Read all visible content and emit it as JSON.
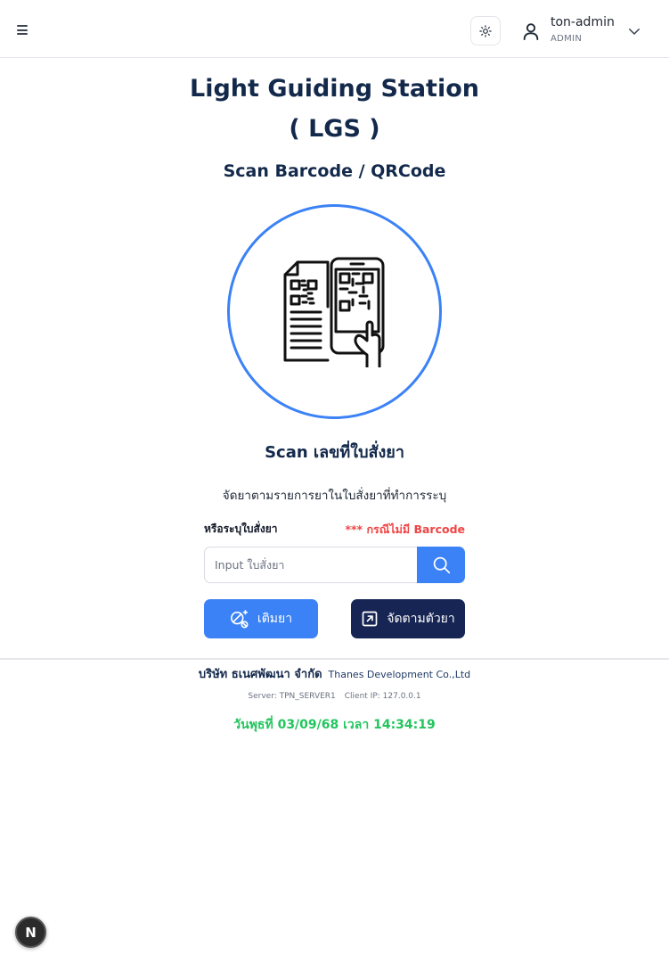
{
  "header": {
    "user_name": "ton-admin",
    "user_role": "ADMIN",
    "icons": {
      "menu": "hamburger-menu-icon",
      "theme": "sun-icon",
      "user": "user-icon",
      "dropdown": "chevron-down-icon"
    }
  },
  "main": {
    "title_line1": "Light Guiding Station",
    "title_line2": "( LGS )",
    "subtitle": "Scan Barcode / QRCode",
    "scan_label": "Scan เลขที่ใบสั่งยา",
    "instruction": "จัดยาตามรายการยาในใบสั่งยาที่ทำการระบุ",
    "field_label": "หรือระบุใบสั่งยา",
    "field_hint": "*** กรณีไม่มี Barcode",
    "search_input_value": "",
    "search_placeholder": "Input ใบสั่งยา",
    "refill_button_label": "เติมยา",
    "manual_button_label": "จัดตามตัวยา"
  },
  "footer": {
    "company_th": "บริษัท ธเนศพัฒนา จำกัด",
    "company_en": "Thanes Development Co.,Ltd",
    "server": "Server: TPN_SERVER1",
    "client_ip": "Client IP: 127.0.0.1",
    "datetime": "วันพุธที่ 03/09/68 เวลา 14:34:19"
  },
  "badge": {
    "letter": "N"
  },
  "colors": {
    "primary": "#3b82f6",
    "navy": "#172554",
    "heading": "#13294b",
    "hint": "#ef4444",
    "time": "#22c55e"
  }
}
